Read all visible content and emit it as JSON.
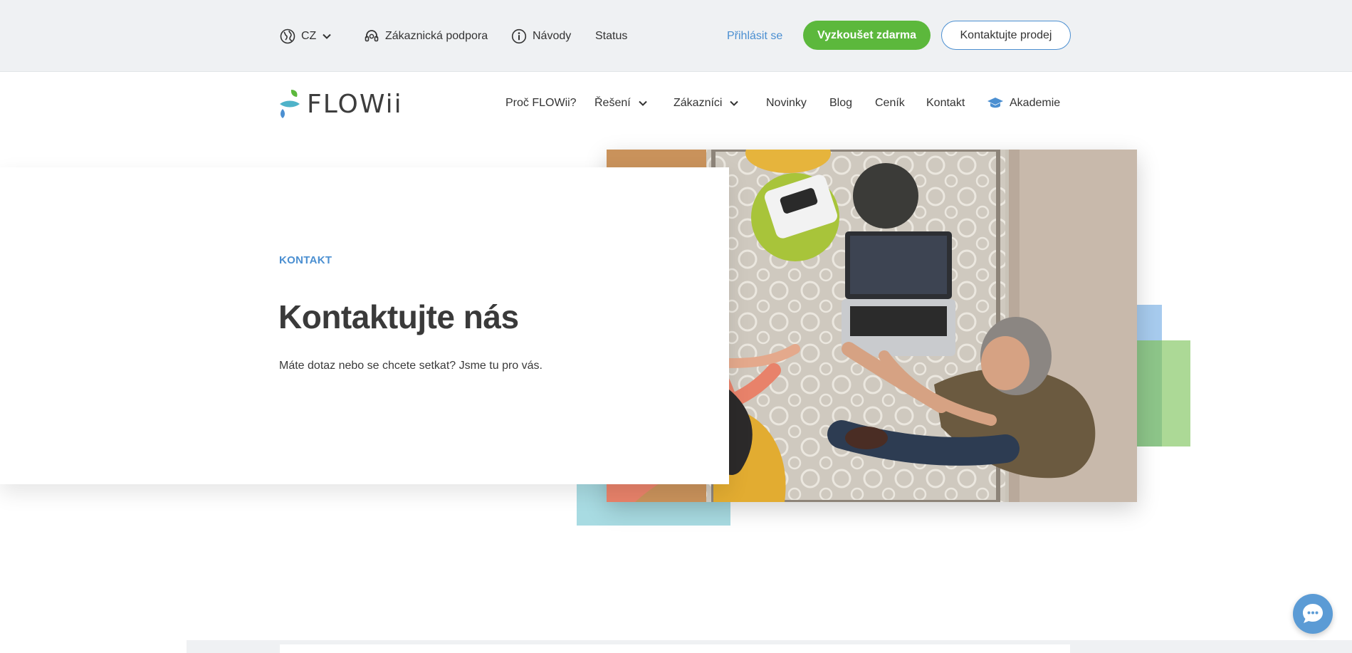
{
  "topbar": {
    "language": "CZ",
    "support": "Zákaznická podpora",
    "guides": "Návody",
    "status": "Status",
    "login": "Přihlásit se",
    "trial_button": "Vyzkoušet zdarma",
    "sales_button": "Kontaktujte prodej"
  },
  "brand": {
    "logo_text": "FLOWii"
  },
  "nav": {
    "why": "Proč FLOWii?",
    "solutions": "Řešení",
    "customers": "Zákazníci",
    "news": "Novinky",
    "blog": "Blog",
    "pricing": "Ceník",
    "contact": "Kontakt",
    "academy": "Akademie"
  },
  "hero": {
    "eyebrow": "KONTAKT",
    "title": "Kontaktujte nás",
    "subtitle": "Máte dotaz nebo se chcete setkat? Jsme tu pro vás."
  },
  "colors": {
    "accent_blue": "#4b8fd1",
    "accent_green": "#5cb83c",
    "topbar_bg": "#eff1f3",
    "deco_teal": "#a8dbe2",
    "deco_blue": "#a7cbee",
    "deco_green": "#8dc589"
  },
  "icons": {
    "language": "globe-icon",
    "support": "headset-icon",
    "guides": "info-icon",
    "academy": "graduation-cap-icon",
    "chat": "chat-bubble-icon"
  }
}
